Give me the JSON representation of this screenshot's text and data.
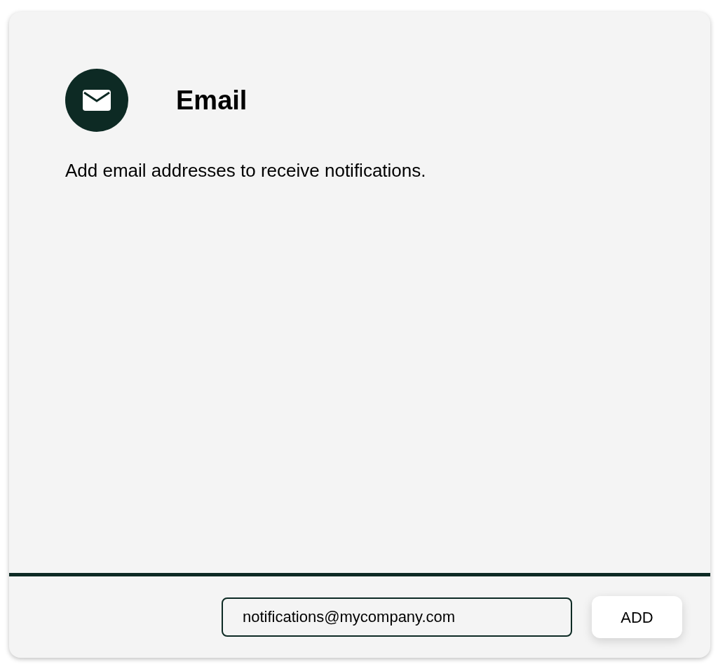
{
  "card": {
    "title": "Email",
    "description": "Add email addresses to receive notifications."
  },
  "email_field": {
    "value": "notifications@mycompany.com"
  },
  "add_button": {
    "label": "ADD"
  }
}
